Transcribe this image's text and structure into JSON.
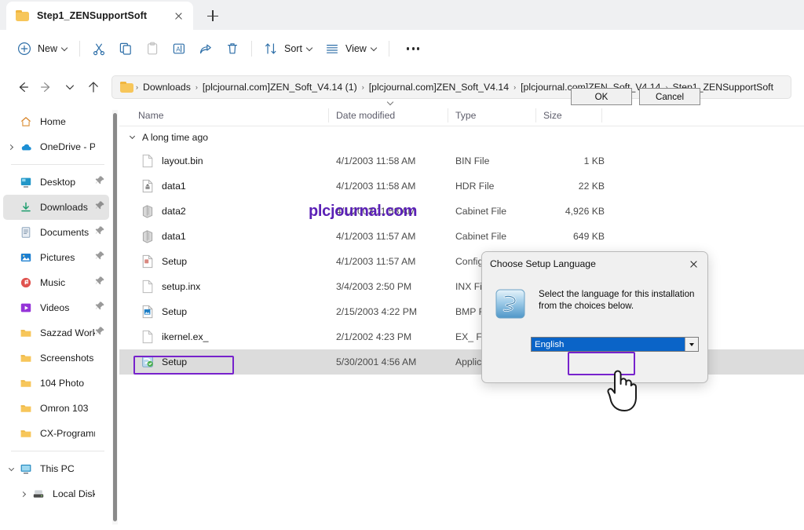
{
  "tab": {
    "title": "Step1_ZENSupportSoft",
    "close_label": "Close tab",
    "new_tab_label": "New tab"
  },
  "toolbar": {
    "new_label": "New",
    "cut_label": "Cut",
    "copy_label": "Copy",
    "paste_label": "Paste",
    "rename_label": "Rename",
    "share_label": "Share",
    "delete_label": "Delete",
    "sort_label": "Sort",
    "view_label": "View",
    "more_label": "See more"
  },
  "address": {
    "back_label": "Back",
    "forward_label": "Forward",
    "recent_label": "Recent locations",
    "up_label": "Up to parent",
    "separator": "›",
    "crumbs": [
      "Downloads",
      "[plcjournal.com]ZEN_Soft_V4.14 (1)",
      "[plcjournal.com]ZEN_Soft_V4.14",
      "[plcjournal.com]ZEN_Soft_V4.14",
      "Step1_ZENSupportSoft"
    ]
  },
  "sidebar": {
    "items": [
      {
        "label": "Home",
        "icon": "home-icon",
        "expand": "none",
        "pinned": false,
        "selected": false,
        "indent": 0
      },
      {
        "label": "OneDrive - Persc",
        "icon": "onedrive-icon",
        "expand": "right",
        "pinned": false,
        "selected": false,
        "indent": 0
      },
      {
        "label": "Desktop",
        "icon": "desktop-icon",
        "expand": "none",
        "pinned": true,
        "selected": false,
        "indent": 0
      },
      {
        "label": "Downloads",
        "icon": "downloads-icon",
        "expand": "none",
        "pinned": true,
        "selected": true,
        "indent": 0
      },
      {
        "label": "Documents",
        "icon": "documents-icon",
        "expand": "none",
        "pinned": true,
        "selected": false,
        "indent": 0
      },
      {
        "label": "Pictures",
        "icon": "pictures-icon",
        "expand": "none",
        "pinned": true,
        "selected": false,
        "indent": 0
      },
      {
        "label": "Music",
        "icon": "music-icon",
        "expand": "none",
        "pinned": true,
        "selected": false,
        "indent": 0
      },
      {
        "label": "Videos",
        "icon": "videos-icon",
        "expand": "none",
        "pinned": true,
        "selected": false,
        "indent": 0
      },
      {
        "label": "Sazzad Work",
        "icon": "folder-icon",
        "expand": "none",
        "pinned": true,
        "selected": false,
        "indent": 0
      },
      {
        "label": "Screenshots",
        "icon": "folder-icon",
        "expand": "none",
        "pinned": false,
        "selected": false,
        "indent": 0
      },
      {
        "label": "104 Photo",
        "icon": "folder-icon",
        "expand": "none",
        "pinned": false,
        "selected": false,
        "indent": 0
      },
      {
        "label": "Omron 103",
        "icon": "folder-icon",
        "expand": "none",
        "pinned": false,
        "selected": false,
        "indent": 0
      },
      {
        "label": "CX-Programmer",
        "icon": "folder-icon",
        "expand": "none",
        "pinned": false,
        "selected": false,
        "indent": 0
      },
      {
        "label": "This PC",
        "icon": "pc-icon",
        "expand": "down",
        "pinned": false,
        "selected": false,
        "indent": 0
      },
      {
        "label": "Local Disk (C:)",
        "icon": "drive-icon",
        "expand": "right",
        "pinned": false,
        "selected": false,
        "indent": 1
      }
    ]
  },
  "filelist": {
    "columns": [
      "Name",
      "Date modified",
      "Type",
      "Size"
    ],
    "sorted_column": "Date modified",
    "group_header": "A long time ago",
    "rows": [
      {
        "name": "layout.bin",
        "date": "4/1/2003 11:58 AM",
        "type": "BIN File",
        "size": "1 KB",
        "icon": "blank-file-icon",
        "selected": false
      },
      {
        "name": "data1",
        "date": "4/1/2003 11:58 AM",
        "type": "HDR File",
        "size": "22 KB",
        "icon": "hdr-file-icon",
        "selected": false
      },
      {
        "name": "data2",
        "date": "4/1/2003 11:58 AM",
        "type": "Cabinet File",
        "size": "4,926 KB",
        "icon": "cabinet-icon",
        "selected": false
      },
      {
        "name": "data1",
        "date": "4/1/2003 11:57 AM",
        "type": "Cabinet File",
        "size": "649 KB",
        "icon": "cabinet-icon",
        "selected": false
      },
      {
        "name": "Setup",
        "date": "4/1/2003 11:57 AM",
        "type": "Configu",
        "size": "",
        "icon": "config-file-icon",
        "selected": false
      },
      {
        "name": "setup.inx",
        "date": "3/4/2003 2:50 PM",
        "type": "INX File",
        "size": "",
        "icon": "blank-file-icon",
        "selected": false
      },
      {
        "name": "Setup",
        "date": "2/15/2003 4:22 PM",
        "type": "BMP File",
        "size": "",
        "icon": "bmp-file-icon",
        "selected": false
      },
      {
        "name": "ikernel.ex_",
        "date": "2/1/2002 4:23 PM",
        "type": "EX_ File",
        "size": "",
        "icon": "blank-file-icon",
        "selected": false
      },
      {
        "name": "Setup",
        "date": "5/30/2001 4:56 AM",
        "type": "Applica",
        "size": "",
        "icon": "app-exe-icon",
        "selected": true
      }
    ]
  },
  "watermark": {
    "text": "plcjournal.com",
    "color": "#5b21b6"
  },
  "dialog": {
    "title": "Choose Setup Language",
    "close_label": "Close",
    "message": "Select the language for this installation from the choices below.",
    "language_selected": "English",
    "dropdown_label": "Open language list",
    "ok_label": "OK",
    "cancel_label": "Cancel",
    "icon": "installshield-icon"
  },
  "annotations": {
    "accent_color": "#7722cc",
    "highlighted_items": [
      "setup-exe-row-name",
      "dialog-ok-button"
    ]
  },
  "cursor": {
    "type": "hand-pointer-cursor"
  }
}
